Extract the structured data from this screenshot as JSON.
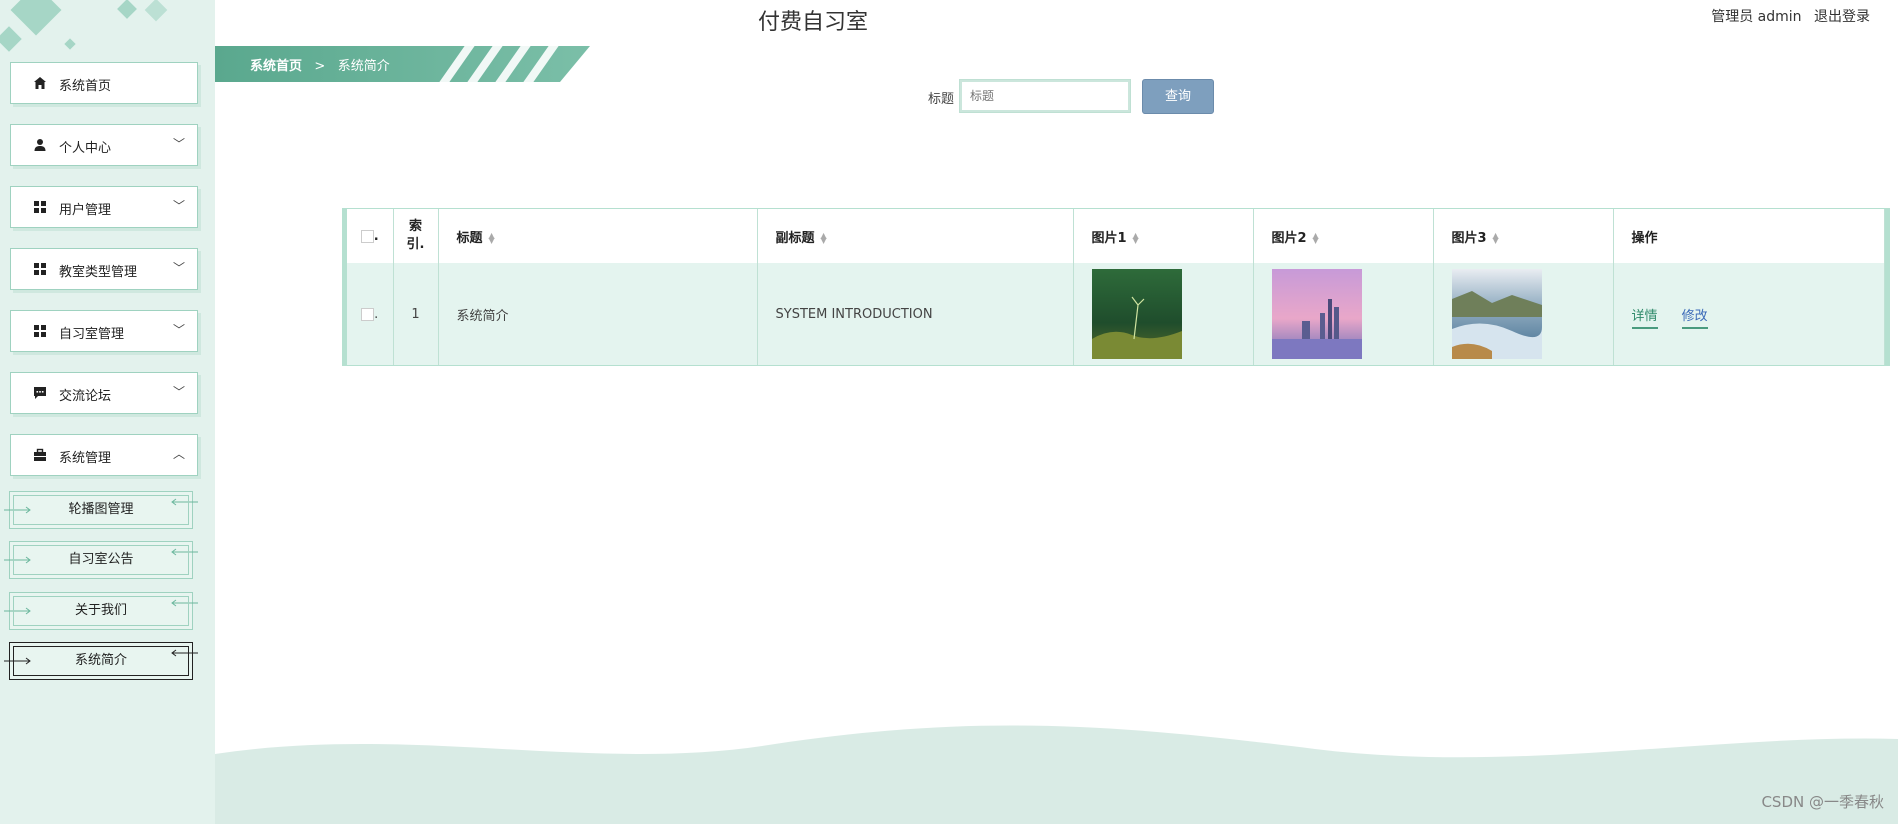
{
  "header": {
    "app_title": "付费自习室",
    "user_label": "管理员 admin",
    "logout": "退出登录"
  },
  "breadcrumb": {
    "home": "系统首页",
    "sep": ">",
    "current": "系统简介"
  },
  "search": {
    "label": "标题",
    "placeholder": "标题",
    "button": "查询"
  },
  "sidebar": {
    "items": [
      {
        "label": "系统首页",
        "icon": "home-icon",
        "chevron": ""
      },
      {
        "label": "个人中心",
        "icon": "person-icon",
        "chevron": "﹀"
      },
      {
        "label": "用户管理",
        "icon": "grid-icon",
        "chevron": "﹀"
      },
      {
        "label": "教室类型管理",
        "icon": "grid-icon",
        "chevron": "﹀"
      },
      {
        "label": "自习室管理",
        "icon": "grid-icon",
        "chevron": "﹀"
      },
      {
        "label": "交流论坛",
        "icon": "chat-icon",
        "chevron": "﹀"
      },
      {
        "label": "系统管理",
        "icon": "briefcase-icon",
        "chevron": "︿"
      }
    ],
    "subitems": [
      {
        "label": "轮播图管理"
      },
      {
        "label": "自习室公告"
      },
      {
        "label": "关于我们"
      },
      {
        "label": "系统简介"
      }
    ]
  },
  "table": {
    "headers": [
      "",
      "索引",
      "标题",
      "副标题",
      "图片1",
      "图片2",
      "图片3",
      "操作"
    ],
    "index_header_line1": "索",
    "index_header_line2": "引.",
    "rows": [
      {
        "index": "1",
        "title": "系统简介",
        "subtitle": "SYSTEM INTRODUCTION",
        "actions": [
          "详情",
          "修改"
        ]
      }
    ]
  },
  "watermark": "CSDN @一季春秋",
  "colors": {
    "accent": "#5aa88e",
    "sidebar_bg": "#e3f2ed",
    "row_bg": "#e4f4ef",
    "button": "#7e9fbe"
  }
}
